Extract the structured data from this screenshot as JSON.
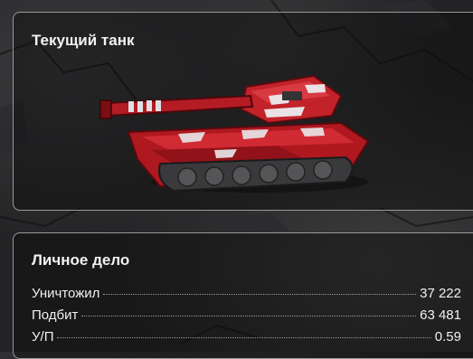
{
  "current_tank": {
    "title": "Текущий танк"
  },
  "personal_record": {
    "title": "Личное дело",
    "stats": [
      {
        "label": "Уничтожил",
        "value": "37 222"
      },
      {
        "label": "Подбит",
        "value": "63 481"
      },
      {
        "label": "У/П",
        "value": "0.59"
      }
    ]
  },
  "colors": {
    "accent_red": "#c8202a",
    "panel_border": "#9a9a9a",
    "text": "#f2f2f2"
  }
}
